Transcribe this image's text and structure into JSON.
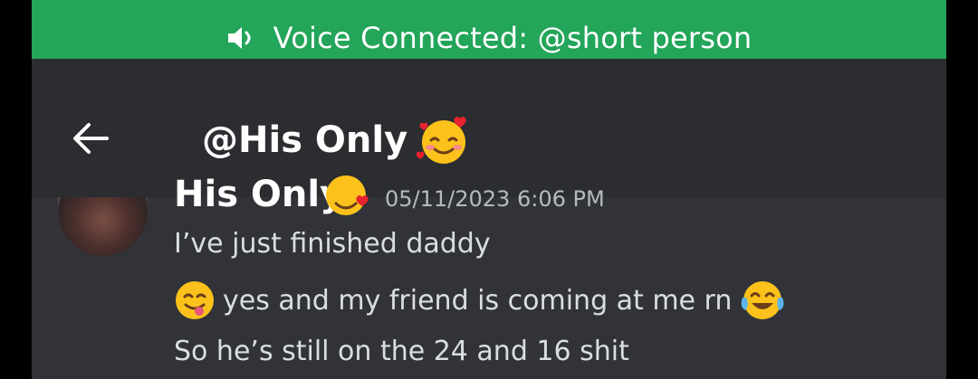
{
  "voice_bar": {
    "text": "Voice Connected: @short person",
    "color": "#23a55a"
  },
  "header": {
    "title": "@His Only",
    "title_emoji": "smiling-face-with-hearts"
  },
  "messages": {
    "author": "His Only",
    "timestamp": "05/11/2023 6:06 PM",
    "items": [
      {
        "text": "I’ve just finished daddy"
      },
      {
        "leading_emoji": "face-savoring-food",
        "text": "yes and my friend is coming at me rn",
        "trailing_emoji": "face-with-tears-of-joy"
      },
      {
        "text": "So he’s still on the 24 and 16 shit"
      }
    ]
  }
}
